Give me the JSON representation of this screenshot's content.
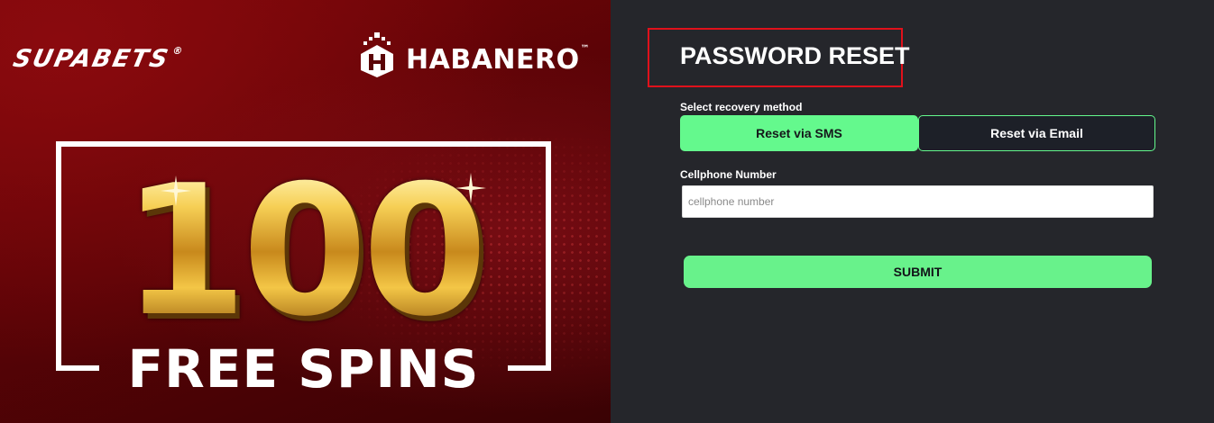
{
  "promo": {
    "supabets_logo": "SUPABETS",
    "supabets_mark": "®",
    "habanero_logo": "HABANERO",
    "habanero_mark": "™",
    "headline_number": "100",
    "headline_text": "FREE SPINS"
  },
  "form": {
    "title": "PASSWORD RESET",
    "recovery_label": "Select recovery method",
    "option_sms": "Reset via SMS",
    "option_email": "Reset via Email",
    "selected_option": "sms",
    "phone_label": "Cellphone Number",
    "phone_placeholder": "cellphone number",
    "phone_value": "",
    "submit_label": "SUBMIT"
  },
  "colors": {
    "accent_green": "#64f98d",
    "highlight_red": "#e0111b",
    "panel_bg": "#25262b",
    "promo_red": "#7a0508",
    "gold": "#e7b53a"
  },
  "icons": {
    "habanero_icon": "habanero-h-icon",
    "sparkle_icon": "sparkle-icon"
  }
}
